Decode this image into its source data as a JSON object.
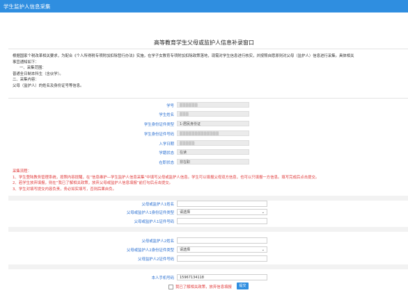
{
  "app": {
    "title": "学生监护人信息采集"
  },
  "page_title": "高等教育学生父母或监护人信息补录窗口",
  "intro": [
    "根据国家个税改革相关要求，为配合《个人所得税专项附加扣除暂行办法》实施，在学子女教育专项附加扣除政策落地，现需对学生信息进行核实，并按照自愿原则对父母（监护人）信息进行采集。具体相关",
    "事宜通知如下：",
    "一、采集范围：",
    "普通全日制本科生（含伙学）。",
    "二、采集内容：",
    "父母（监护人）的姓名及身份证号等信息。"
  ],
  "student": [
    {
      "label": "学号",
      "value": ""
    },
    {
      "label": "学生姓名",
      "value": ""
    },
    {
      "label": "学生身份证件类型",
      "value": "1-居民身份证"
    },
    {
      "label": "学生身份证件号码",
      "value": ""
    },
    {
      "label": "入学日期",
      "value": ""
    },
    {
      "label": "学籍状态",
      "value": "在读"
    },
    {
      "label": "在职状态",
      "value": "非在职"
    }
  ],
  "process": [
    "采集流程：",
    "1、学生登陆教务管理系统，按照内容提醒，在“信息维护—学生监护人信息采集”中填写父母或监护人信息。学生可以填报父母双方信息，也可以只填报一方信息。填写完成后点击提交。",
    "2、若学生放弃填报，则在“我已了解相关政策，放弃父母或监护人信息填报”前打勾后点击提交。",
    "3、学生对填写提交内容负责，务必如实填写，否则后果自负。"
  ],
  "guardian1": {
    "name_label": "父母或监护人1姓名",
    "name_value": "",
    "idtype_label": "父母或监护人1身份证件类型",
    "idtype_value": "请选择",
    "idno_label": "父母或监护人1证件号码",
    "idno_value": ""
  },
  "guardian2": {
    "name_label": "父母或监护人2姓名",
    "name_value": "",
    "idtype_label": "父母或监护人2身份证件类型",
    "idtype_value": "请选择",
    "idno_label": "父母监护人2证件号码",
    "idno_value": ""
  },
  "phone": {
    "label": "本人手机号码",
    "value": "15967134118"
  },
  "agree_label": "我已了解相关政策，放弃信息填报",
  "submit_label": "提交",
  "colors": {
    "accent": "#2f8ee0",
    "label": "#2a6fd1",
    "warning": "#e03a3a"
  }
}
